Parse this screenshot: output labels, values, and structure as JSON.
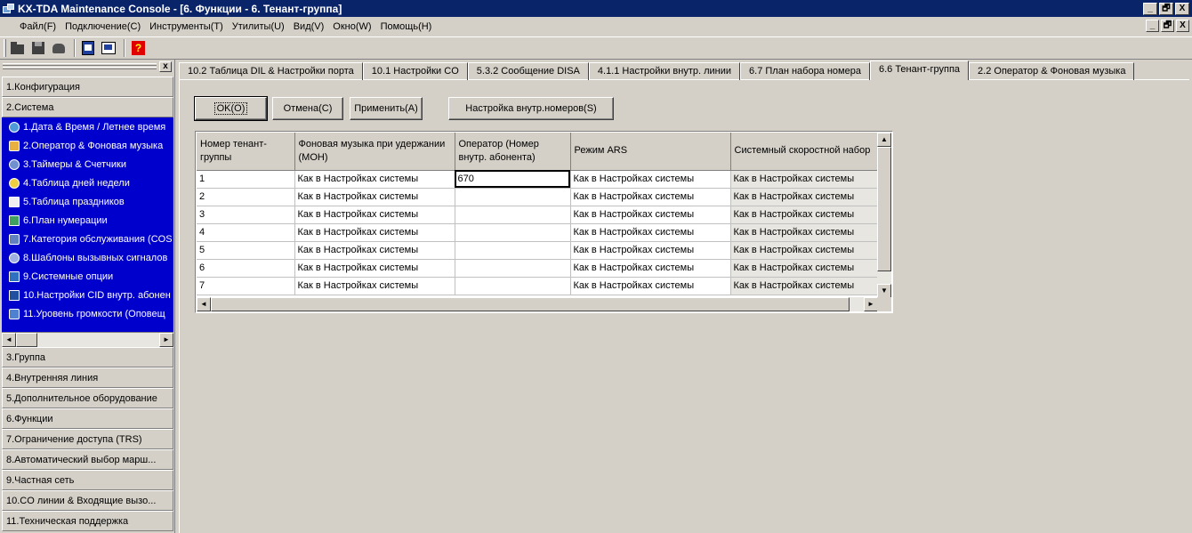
{
  "window": {
    "title": "KX-TDA Maintenance Console - [6. Функции - 6. Тенант-группа]",
    "btn_min": "_",
    "btn_max": "🗗",
    "btn_close": "X"
  },
  "menu": [
    "Файл(F)",
    "Подключение(C)",
    "Инструменты(T)",
    "Утилиты(U)",
    "Вид(V)",
    "Окно(W)",
    "Помощь(H)"
  ],
  "toolbar": {
    "icons": [
      "folder-icon",
      "save-icon",
      "phone-icon",
      "document-icon",
      "print-icon",
      "help-icon"
    ],
    "help_glyph": "?"
  },
  "sidebar": {
    "close_glyph": "x",
    "categories_top": [
      "1.Конфигурация",
      "2.Система"
    ],
    "system_items": [
      {
        "label": "1.Дата & Время / Летнее время",
        "icon": "clock-icon"
      },
      {
        "label": "2.Оператор & Фоновая музыка",
        "icon": "operator-icon"
      },
      {
        "label": "3.Таймеры & Счетчики",
        "icon": "timer-icon"
      },
      {
        "label": "4.Таблица дней недели",
        "icon": "alarm-clock-icon"
      },
      {
        "label": "5.Таблица праздников",
        "icon": "holiday-icon"
      },
      {
        "label": "6.План нумерации",
        "icon": "numbering-plan-icon"
      },
      {
        "label": "7.Категория обслуживания (COS",
        "icon": "service-class-icon"
      },
      {
        "label": "8.Шаблоны вызывных сигналов",
        "icon": "ring-pattern-icon"
      },
      {
        "label": "9.Системные опции",
        "icon": "options-icon"
      },
      {
        "label": "10.Настройки CID внутр. абонен",
        "icon": "cid-icon"
      },
      {
        "label": "11.Уровень громкости (Оповещ",
        "icon": "volume-icon"
      }
    ],
    "categories_bottom": [
      "3.Группа",
      "4.Внутренняя линия",
      "5.Дополнительное оборудование",
      "6.Функции",
      "7.Ограничение доступа (TRS)",
      "8.Автоматический выбор марш...",
      "9.Частная сеть",
      "10.CO линии & Входящие вызо...",
      "11.Техническая поддержка"
    ]
  },
  "tabs": [
    {
      "label": "10.2 Таблица DIL & Настройки порта",
      "active": false
    },
    {
      "label": "10.1 Настройки CO",
      "active": false
    },
    {
      "label": "5.3.2 Сообщение DISA",
      "active": false
    },
    {
      "label": "4.1.1 Настройки внутр. линии",
      "active": false
    },
    {
      "label": "6.7 План набора номера",
      "active": false
    },
    {
      "label": "6.6 Тенант-группа",
      "active": true
    },
    {
      "label": "2.2 Оператор & Фоновая музыка",
      "active": false
    }
  ],
  "buttons": {
    "ok": "OK(O)",
    "cancel": "Отмена(C)",
    "apply": "Применить(A)",
    "ext_settings": "Настройка внутр.номеров(S)"
  },
  "grid": {
    "columns": [
      "Номер тенант-группы",
      "Фоновая музыка при удержании (MOH)",
      "Оператор (Номер внутр. абонента)",
      "Режим ARS",
      "Системный скоростной набор"
    ],
    "rows": [
      [
        "1",
        "Как в Настройках системы",
        "670",
        "Как в Настройках системы",
        "Как в Настройках системы"
      ],
      [
        "2",
        "Как в Настройках системы",
        "",
        "Как в Настройках системы",
        "Как в Настройках системы"
      ],
      [
        "3",
        "Как в Настройках системы",
        "",
        "Как в Настройках системы",
        "Как в Настройках системы"
      ],
      [
        "4",
        "Как в Настройках системы",
        "",
        "Как в Настройках системы",
        "Как в Настройках системы"
      ],
      [
        "5",
        "Как в Настройках системы",
        "",
        "Как в Настройках системы",
        "Как в Настройках системы"
      ],
      [
        "6",
        "Как в Настройках системы",
        "",
        "Как в Настройках системы",
        "Как в Настройках системы"
      ],
      [
        "7",
        "Как в Настройках системы",
        "",
        "Как в Настройках системы",
        "Как в Настройках системы"
      ]
    ],
    "arrows": {
      "up": "▲",
      "down": "▼",
      "left": "◄",
      "right": "►"
    }
  },
  "colors": {
    "titlebar": "#0a246a",
    "sidebar_selected": "#0000cc",
    "face": "#d4d0c8"
  }
}
